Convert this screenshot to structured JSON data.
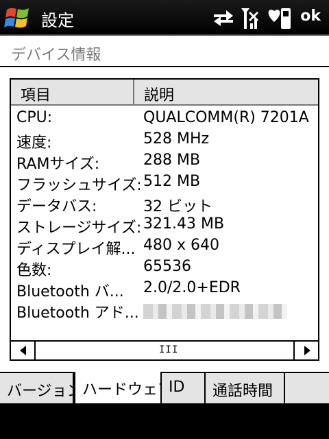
{
  "titlebar": {
    "title": "設定",
    "ok": "ok"
  },
  "page": {
    "header": "デバイス情報"
  },
  "listview": {
    "columns": [
      "項目",
      "説明"
    ],
    "rows": [
      {
        "key": "CPU:",
        "value": "QUALCOMM(R) 7201A"
      },
      {
        "key": "速度:",
        "value": "528 MHz"
      },
      {
        "key": "RAMサイズ:",
        "value": "288 MB"
      },
      {
        "key": "フラッシュサイズ:",
        "value": "512 MB"
      },
      {
        "key": "データバス:",
        "value": "32 ビット"
      },
      {
        "key": "ストレージサイズ:",
        "value": "321.43 MB"
      },
      {
        "key": "ディスプレイ解...",
        "value": "480 x 640"
      },
      {
        "key": "色数:",
        "value": "65536"
      },
      {
        "key": "Bluetooth バ...",
        "value": "2.0/2.0+EDR"
      },
      {
        "key": "Bluetooth アド...",
        "value": ""
      }
    ]
  },
  "tabs": [
    {
      "label": "バージョン",
      "active": false
    },
    {
      "label": "ハードウェア",
      "active": true
    },
    {
      "label": "ID",
      "active": false
    },
    {
      "label": "通話時間",
      "active": false
    }
  ],
  "icons": {
    "start": "windows-start-icon",
    "sync": "sync-arrows-icon",
    "signal": "signal-strength-icon",
    "battery": "phone-battery-icon"
  }
}
